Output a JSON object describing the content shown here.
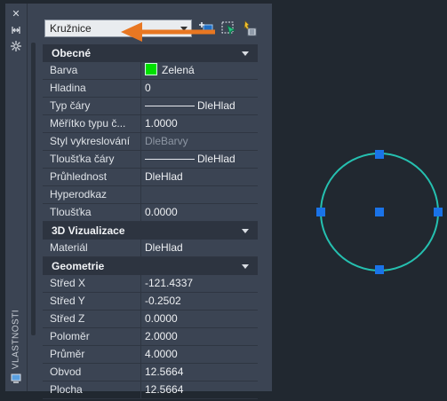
{
  "palette": {
    "vertical_title": "VLASTNOSTI",
    "selector": {
      "value": "Kružnice"
    },
    "sections": [
      {
        "title": "Obecné",
        "rows": [
          {
            "label": "Barva",
            "value": "Zelená",
            "swatch": "#00e000"
          },
          {
            "label": "Hladina",
            "value": "0"
          },
          {
            "label": "Typ čáry",
            "value": "DleHlad",
            "line": true
          },
          {
            "label": "Měřítko typu č...",
            "value": "1.0000"
          },
          {
            "label": "Styl vykreslování",
            "value": "DleBarvy",
            "dim": true
          },
          {
            "label": "Tloušťka čáry",
            "value": "DleHlad",
            "line": true
          },
          {
            "label": "Průhlednost",
            "value": "DleHlad"
          },
          {
            "label": "Hyperodkaz",
            "value": ""
          },
          {
            "label": "Tloušťka",
            "value": "0.0000"
          }
        ]
      },
      {
        "title": "3D Vizualizace",
        "rows": [
          {
            "label": "Materiál",
            "value": "DleHlad"
          }
        ]
      },
      {
        "title": "Geometrie",
        "rows": [
          {
            "label": "Střed X",
            "value": "-121.4337"
          },
          {
            "label": "Střed Y",
            "value": "-0.2502"
          },
          {
            "label": "Střed Z",
            "value": "0.0000"
          },
          {
            "label": "Poloměr",
            "value": "2.0000"
          },
          {
            "label": "Průměr",
            "value": "4.0000"
          },
          {
            "label": "Obvod",
            "value": "12.5664"
          },
          {
            "label": "Plocha",
            "value": "12.5664"
          }
        ]
      }
    ]
  },
  "colors": {
    "accent": "#e87722",
    "grip": "#1a73e8",
    "circle": "#25c0b0"
  }
}
